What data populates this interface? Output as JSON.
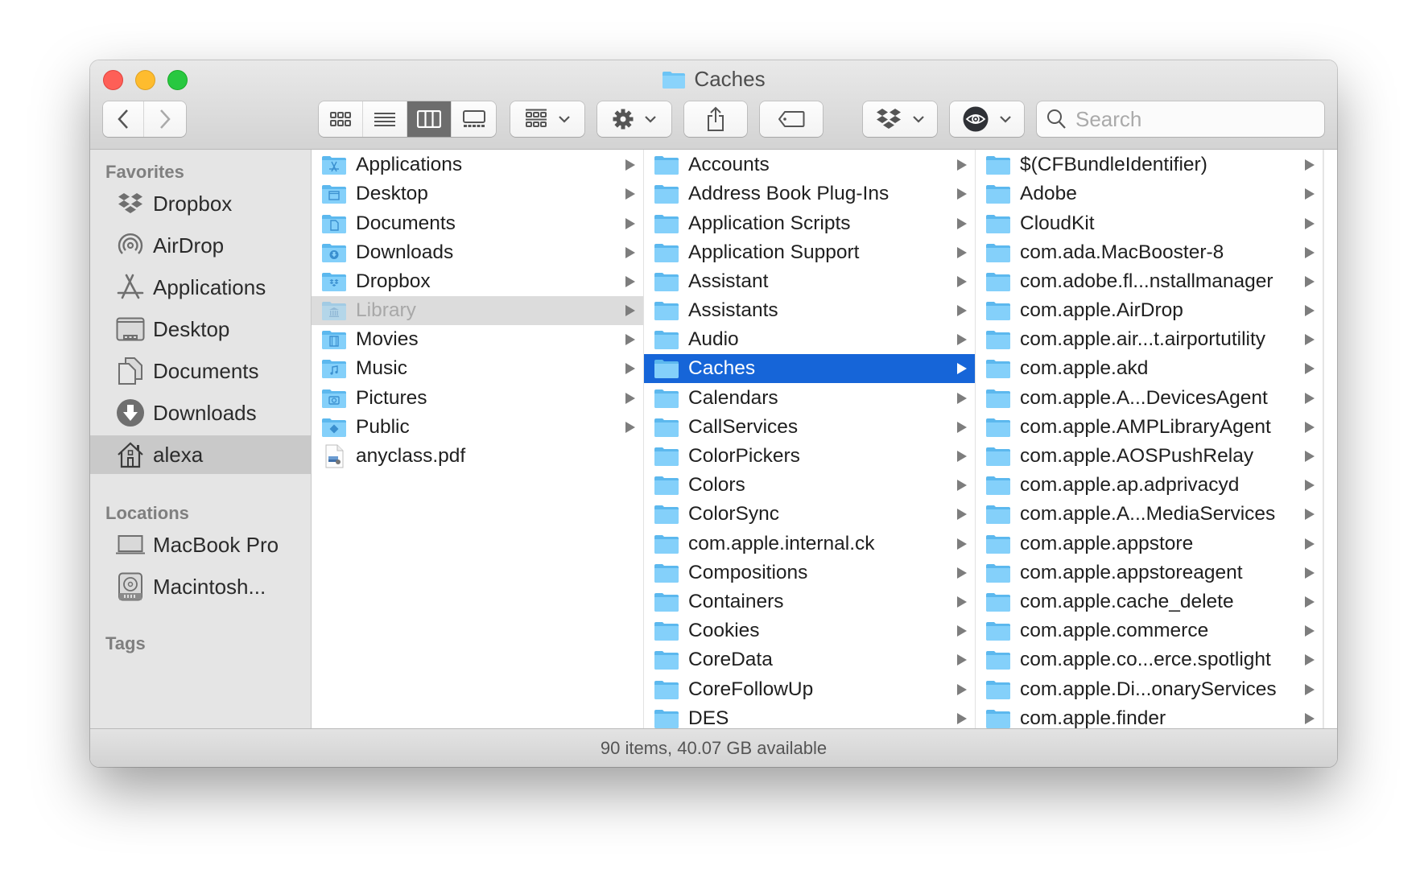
{
  "window": {
    "title": "Caches",
    "accent_color": "#1665d8"
  },
  "toolbar": {
    "back_icon": "chevron-left-icon",
    "forward_icon": "chevron-right-icon",
    "view_modes": [
      "icon-view",
      "list-view",
      "column-view",
      "gallery-view"
    ],
    "active_view": "column-view",
    "group_menu": "group-by-icon",
    "action_menu": "gear-icon",
    "share": "share-icon",
    "tags": "tag-icon",
    "dropbox_menu": "dropbox-icon",
    "eye_menu": "eye-icon",
    "search_placeholder": "Search"
  },
  "sidebar": {
    "favorites_label": "Favorites",
    "favorites": [
      {
        "label": "Dropbox",
        "icon": "dropbox-icon"
      },
      {
        "label": "AirDrop",
        "icon": "airdrop-icon"
      },
      {
        "label": "Applications",
        "icon": "applications-icon"
      },
      {
        "label": "Desktop",
        "icon": "desktop-icon"
      },
      {
        "label": "Documents",
        "icon": "documents-icon"
      },
      {
        "label": "Downloads",
        "icon": "downloads-icon"
      },
      {
        "label": "alexa",
        "icon": "home-icon",
        "selected": true
      }
    ],
    "locations_label": "Locations",
    "locations": [
      {
        "label": "MacBook Pro",
        "icon": "laptop-icon"
      },
      {
        "label": "Macintosh...",
        "icon": "hard-drive-icon"
      }
    ],
    "tags_label": "Tags"
  },
  "columns": [
    {
      "items": [
        {
          "label": "Applications",
          "type": "folder",
          "badge": "applications",
          "arrow": true
        },
        {
          "label": "Desktop",
          "type": "folder",
          "badge": "desktop",
          "arrow": true
        },
        {
          "label": "Documents",
          "type": "folder",
          "badge": "documents",
          "arrow": true
        },
        {
          "label": "Downloads",
          "type": "folder",
          "badge": "downloads",
          "arrow": true
        },
        {
          "label": "Dropbox",
          "type": "folder",
          "badge": "dropbox",
          "arrow": true
        },
        {
          "label": "Library",
          "type": "folder",
          "badge": "library",
          "arrow": true,
          "state": "parent"
        },
        {
          "label": "Movies",
          "type": "folder",
          "badge": "movies",
          "arrow": true
        },
        {
          "label": "Music",
          "type": "folder",
          "badge": "music",
          "arrow": true
        },
        {
          "label": "Pictures",
          "type": "folder",
          "badge": "pictures",
          "arrow": true
        },
        {
          "label": "Public",
          "type": "folder",
          "badge": "public",
          "arrow": true
        },
        {
          "label": "anyclass.pdf",
          "type": "file",
          "arrow": false
        }
      ]
    },
    {
      "items": [
        {
          "label": "Accounts",
          "type": "folder",
          "arrow": true
        },
        {
          "label": "Address Book Plug-Ins",
          "type": "folder",
          "arrow": true
        },
        {
          "label": "Application Scripts",
          "type": "folder",
          "arrow": true
        },
        {
          "label": "Application Support",
          "type": "folder",
          "arrow": true
        },
        {
          "label": "Assistant",
          "type": "folder",
          "arrow": true
        },
        {
          "label": "Assistants",
          "type": "folder",
          "arrow": true
        },
        {
          "label": "Audio",
          "type": "folder",
          "arrow": true
        },
        {
          "label": "Caches",
          "type": "folder",
          "arrow": true,
          "state": "selected"
        },
        {
          "label": "Calendars",
          "type": "folder",
          "arrow": true
        },
        {
          "label": "CallServices",
          "type": "folder",
          "arrow": true
        },
        {
          "label": "ColorPickers",
          "type": "folder",
          "arrow": true
        },
        {
          "label": "Colors",
          "type": "folder",
          "arrow": true
        },
        {
          "label": "ColorSync",
          "type": "folder",
          "arrow": true
        },
        {
          "label": "com.apple.internal.ck",
          "type": "folder",
          "arrow": true
        },
        {
          "label": "Compositions",
          "type": "folder",
          "arrow": true
        },
        {
          "label": "Containers",
          "type": "folder",
          "arrow": true
        },
        {
          "label": "Cookies",
          "type": "folder",
          "arrow": true
        },
        {
          "label": "CoreData",
          "type": "folder",
          "arrow": true
        },
        {
          "label": "CoreFollowUp",
          "type": "folder",
          "arrow": true
        },
        {
          "label": "DES",
          "type": "folder",
          "arrow": true
        }
      ]
    },
    {
      "items": [
        {
          "label": "$(CFBundleIdentifier)",
          "type": "folder",
          "arrow": true
        },
        {
          "label": "Adobe",
          "type": "folder",
          "arrow": true
        },
        {
          "label": "CloudKit",
          "type": "folder",
          "arrow": true
        },
        {
          "label": "com.ada.MacBooster-8",
          "type": "folder",
          "arrow": true
        },
        {
          "label": "com.adobe.fl...nstallmanager",
          "type": "folder",
          "arrow": true
        },
        {
          "label": "com.apple.AirDrop",
          "type": "folder",
          "arrow": true
        },
        {
          "label": "com.apple.air...t.airportutility",
          "type": "folder",
          "arrow": true
        },
        {
          "label": "com.apple.akd",
          "type": "folder",
          "arrow": true
        },
        {
          "label": "com.apple.A...DevicesAgent",
          "type": "folder",
          "arrow": true
        },
        {
          "label": "com.apple.AMPLibraryAgent",
          "type": "folder",
          "arrow": true
        },
        {
          "label": "com.apple.AOSPushRelay",
          "type": "folder",
          "arrow": true
        },
        {
          "label": "com.apple.ap.adprivacyd",
          "type": "folder",
          "arrow": true
        },
        {
          "label": "com.apple.A...MediaServices",
          "type": "folder",
          "arrow": true
        },
        {
          "label": "com.apple.appstore",
          "type": "folder",
          "arrow": true
        },
        {
          "label": "com.apple.appstoreagent",
          "type": "folder",
          "arrow": true
        },
        {
          "label": "com.apple.cache_delete",
          "type": "folder",
          "arrow": true
        },
        {
          "label": "com.apple.commerce",
          "type": "folder",
          "arrow": true
        },
        {
          "label": "com.apple.co...erce.spotlight",
          "type": "folder",
          "arrow": true
        },
        {
          "label": "com.apple.Di...onaryServices",
          "type": "folder",
          "arrow": true
        },
        {
          "label": "com.apple.finder",
          "type": "folder",
          "arrow": true
        }
      ]
    }
  ],
  "status": {
    "text": "90 items, 40.07 GB available"
  }
}
